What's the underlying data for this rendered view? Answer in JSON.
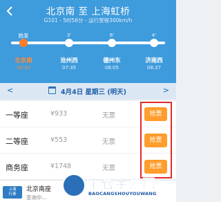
{
  "header": {
    "title": "北京南 至 上海虹桥",
    "subtitle": "G101 - 5时56分 - 运行里程300km/h",
    "back_icon": "chevron-left-icon"
  },
  "route": {
    "depart_tag": "始发",
    "segments": [
      "3'",
      "8'",
      "4'"
    ],
    "stations": [
      {
        "name": "北京南",
        "time": "06:43",
        "active": true
      },
      {
        "name": "沧州西",
        "time": "07:35",
        "active": false
      },
      {
        "name": "德州东",
        "time": "08:05",
        "active": false
      },
      {
        "name": "济南西",
        "time": "08:37",
        "active": false
      }
    ]
  },
  "date_bar": {
    "prev": "<",
    "next": ">",
    "date": "4月4日 星期三 (明天)",
    "calendar_icon": "calendar-icon"
  },
  "seats": [
    {
      "type": "一等座",
      "price": "¥933",
      "availability": "无票",
      "action": "抢票"
    },
    {
      "type": "二等座",
      "price": "¥553",
      "availability": "无票",
      "action": "抢票"
    },
    {
      "type": "商务座",
      "price": "¥1748",
      "availability": "无票",
      "action": "抢票"
    }
  ],
  "bottom": {
    "tag": "上海\n行事",
    "title": "北京南座",
    "subtitle": "查询中..."
  },
  "watermark": {
    "text": "宝仓手游网",
    "url": "BAOCANGSHOUYOUWANG"
  },
  "colors": {
    "header_bg": "#3e9bdc",
    "accent_orange": "#ff9d2d",
    "highlight_red": "#e52a2a"
  }
}
